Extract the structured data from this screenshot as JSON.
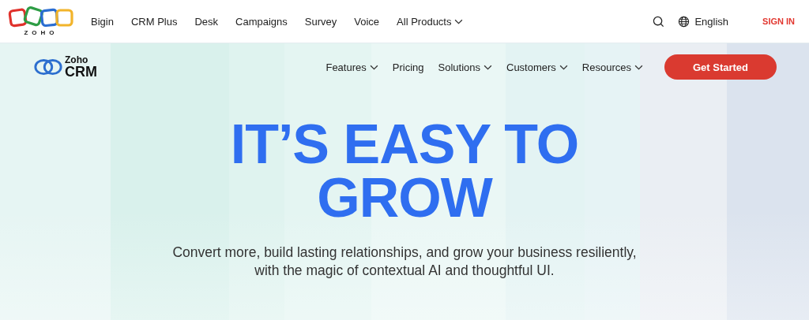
{
  "top_bar": {
    "logo_text": "ZOHO",
    "products": [
      {
        "label": "Bigin",
        "dropdown": false
      },
      {
        "label": "CRM Plus",
        "dropdown": false
      },
      {
        "label": "Desk",
        "dropdown": false
      },
      {
        "label": "Campaigns",
        "dropdown": false
      },
      {
        "label": "Survey",
        "dropdown": false
      },
      {
        "label": "Voice",
        "dropdown": false
      },
      {
        "label": "All Products",
        "dropdown": true
      }
    ],
    "language": "English",
    "sign_in": "SIGN IN"
  },
  "product_nav": {
    "brand_top": "Zoho",
    "brand_bottom": "CRM",
    "items": [
      {
        "label": "Features",
        "dropdown": true
      },
      {
        "label": "Pricing",
        "dropdown": false
      },
      {
        "label": "Solutions",
        "dropdown": true
      },
      {
        "label": "Customers",
        "dropdown": true
      },
      {
        "label": "Resources",
        "dropdown": true
      }
    ],
    "cta": "Get Started"
  },
  "hero": {
    "headline_lines": [
      "IT’S EASY TO",
      "GROW"
    ],
    "subtitle_lines": [
      "Convert more, build lasting relationships, and grow your business resiliently,",
      "with the magic of contextual AI and thoughtful UI."
    ]
  }
}
